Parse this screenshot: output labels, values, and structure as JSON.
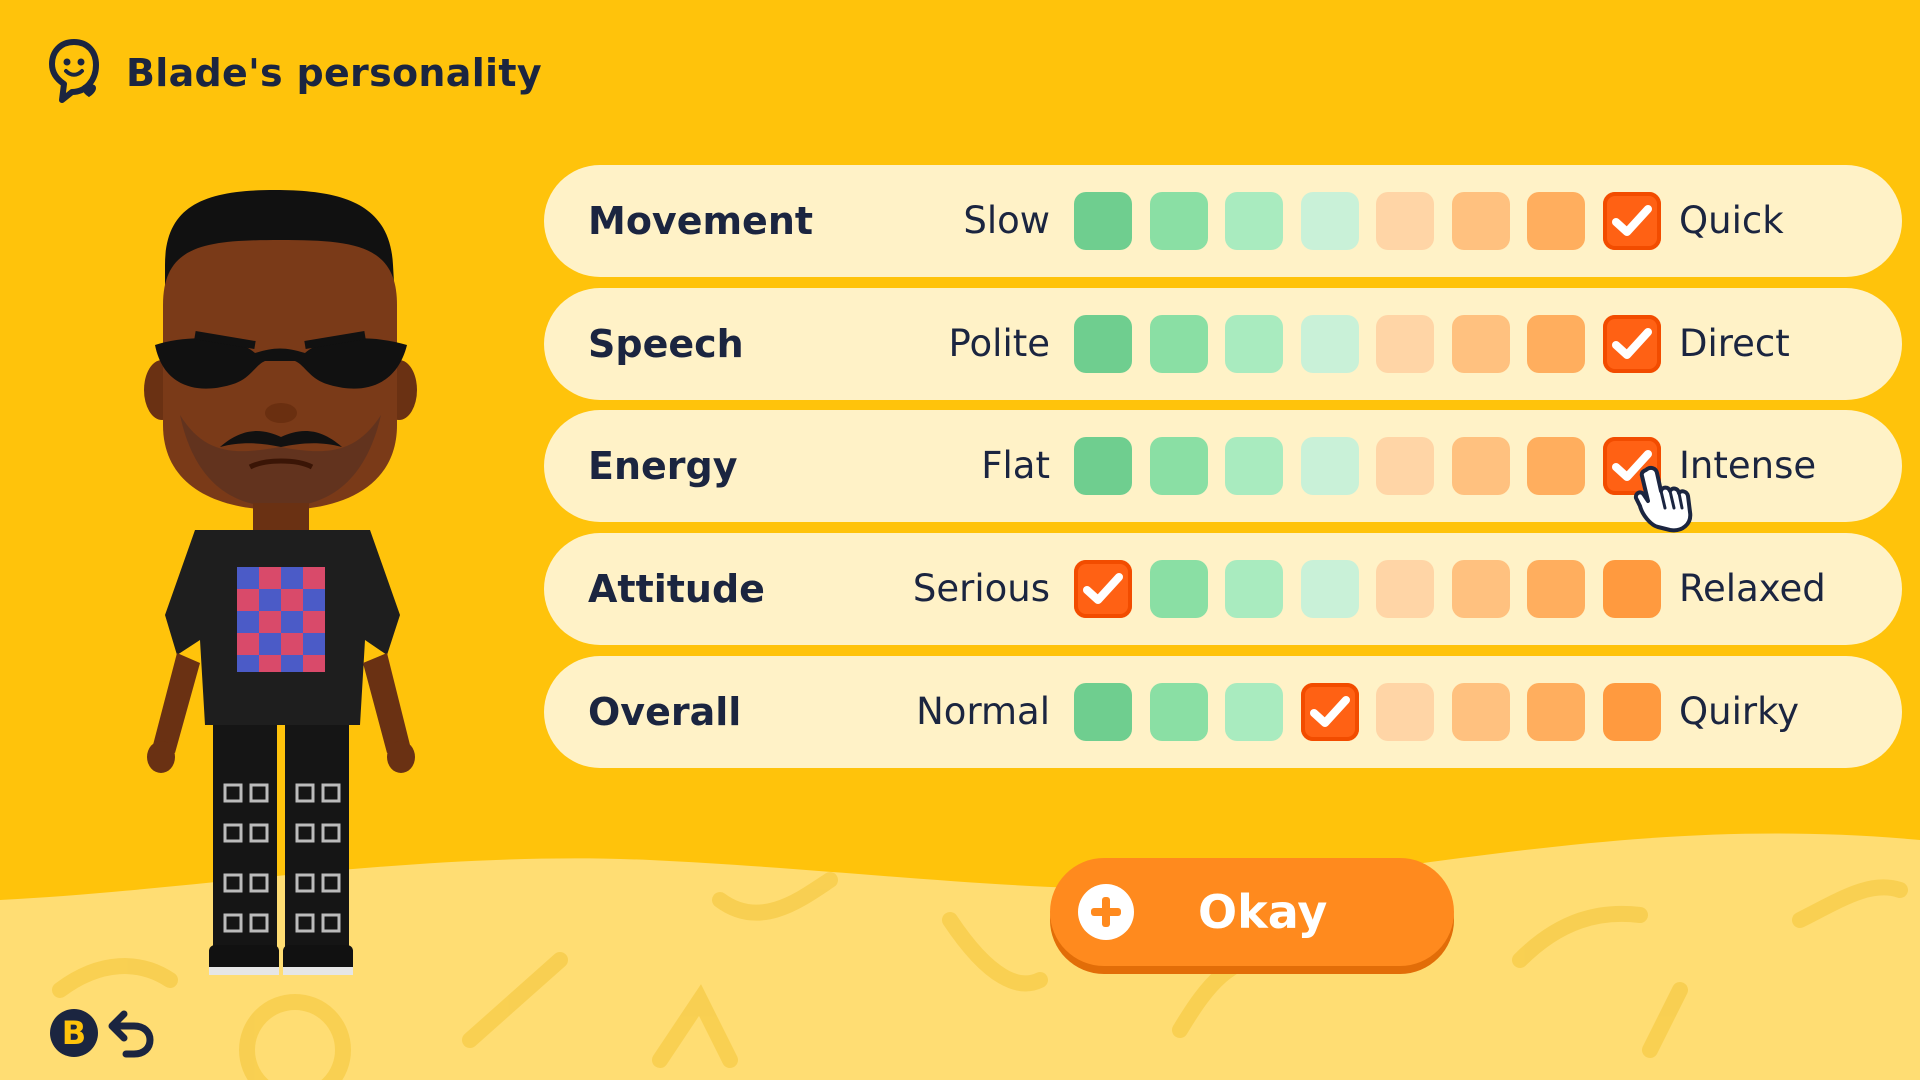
{
  "header": {
    "title": "Blade's personality",
    "icon": "personality-icon"
  },
  "traits": [
    {
      "name": "Movement",
      "low": "Slow",
      "high": "Quick",
      "selected": 8
    },
    {
      "name": "Speech",
      "low": "Polite",
      "high": "Direct",
      "selected": 8
    },
    {
      "name": "Energy",
      "low": "Flat",
      "high": "Intense",
      "selected": 8
    },
    {
      "name": "Attitude",
      "low": "Serious",
      "high": "Relaxed",
      "selected": 1
    },
    {
      "name": "Overall",
      "low": "Normal",
      "high": "Quirky",
      "selected": 4
    }
  ],
  "scale_colors": [
    "#6fce8f",
    "#8adfa4",
    "#a9ebbf",
    "#c9f1d8",
    "#ffd5a6",
    "#ffc17f",
    "#ffae5e",
    "#ff9a3f"
  ],
  "selected_color": "#ff6114",
  "okay_button": {
    "label": "Okay",
    "icon": "plus-icon"
  },
  "back_hint": {
    "button": "B",
    "icon": "undo-icon"
  }
}
